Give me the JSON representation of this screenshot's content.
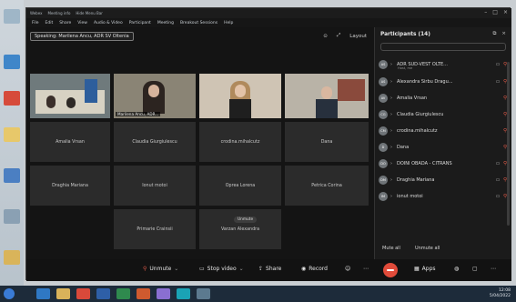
{
  "window": {
    "title_left": "Webex",
    "title_meeting": "Meeting info",
    "title_menu": "Hide Menu Bar"
  },
  "menubar": [
    "File",
    "Edit",
    "Share",
    "View",
    "Audio & Video",
    "Participant",
    "Meeting",
    "Breakout Sessions",
    "Help"
  ],
  "stage": {
    "speaking_label": "Speaking: Marilena Ancu, ADR SV Oltenia",
    "layout_label": "Layout"
  },
  "video_tiles": [
    {
      "name": ""
    },
    {
      "name": "Marilena Ancu, ADR..."
    },
    {
      "name": ""
    },
    {
      "name": ""
    }
  ],
  "tiles": [
    "Amalia Vrsan",
    "Claudia Giurgiulescu",
    "crodina.mihalcutz",
    "Dana",
    "Draghia Mariana",
    "Ionut motoi",
    "Oprea Lorena",
    "Petrica Corina",
    "Primarie Crainsii",
    "Varzan Alexandra"
  ],
  "unmute_pill": "Unmute",
  "toolbar": {
    "unmute": "Unmute",
    "stop_video": "Stop video",
    "share": "Share",
    "record": "Record",
    "apps": "Apps"
  },
  "participants": {
    "title": "Participants (14)",
    "items": [
      {
        "initials": "AS",
        "name": "ADR SUD-VEST OLTE...",
        "sub": "Host, me"
      },
      {
        "initials": "AS",
        "name": "Alexandra Sirbu Dragu..."
      },
      {
        "initials": "AV",
        "name": "Amalia Vrsan"
      },
      {
        "initials": "CG",
        "name": "Claudia Giurgiulescu"
      },
      {
        "initials": "CM",
        "name": "crodina.mihalcutz"
      },
      {
        "initials": "D",
        "name": "Dana"
      },
      {
        "initials": "DO",
        "name": "DOINI OBADA - CITRANS"
      },
      {
        "initials": "DM",
        "name": "Draghia Mariana"
      },
      {
        "initials": "IM",
        "name": "ionut motoi"
      }
    ],
    "mute_all": "Mute all",
    "unmute_all": "Unmute all"
  },
  "taskbar": {
    "time": "12:08",
    "date": "5/04/2022"
  },
  "colors": {
    "end_call": "#e04b3a",
    "muted_mic": "#e25b4a",
    "window_bg": "#121212"
  }
}
